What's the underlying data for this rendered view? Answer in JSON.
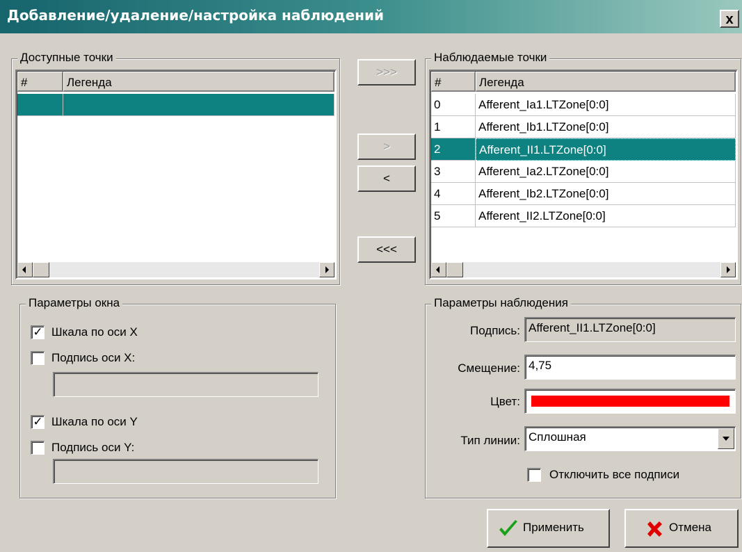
{
  "window": {
    "title": "Добавление/удаление/настройка наблюдений",
    "close_label": "x"
  },
  "available": {
    "group_label": "Доступные точки",
    "col_num": "#",
    "col_legend": "Легенда",
    "rows": [
      {
        "num": "",
        "legend": ""
      }
    ]
  },
  "transfer": {
    "add_all": ">>>",
    "add": ">",
    "remove": "<",
    "remove_all": "<<<"
  },
  "observed": {
    "group_label": "Наблюдаемые точки",
    "col_num": "#",
    "col_legend": "Легенда",
    "selected_index": 2,
    "rows": [
      {
        "num": "0",
        "legend": "Afferent_Ia1.LTZone[0:0]"
      },
      {
        "num": "1",
        "legend": "Afferent_Ib1.LTZone[0:0]"
      },
      {
        "num": "2",
        "legend": "Afferent_II1.LTZone[0:0]"
      },
      {
        "num": "3",
        "legend": "Afferent_Ia2.LTZone[0:0]"
      },
      {
        "num": "4",
        "legend": "Afferent_Ib2.LTZone[0:0]"
      },
      {
        "num": "5",
        "legend": "Afferent_II2.LTZone[0:0]"
      }
    ]
  },
  "window_params": {
    "group_label": "Параметры окна",
    "scale_x": {
      "label": "Шкала по оси X",
      "checked": true
    },
    "caption_x": {
      "label": "Подпись оси X:",
      "checked": false,
      "value": ""
    },
    "scale_y": {
      "label": "Шкала по оси Y",
      "checked": true
    },
    "caption_y": {
      "label": "Подпись оси Y:",
      "checked": false,
      "value": ""
    }
  },
  "obs_params": {
    "group_label": "Параметры наблюдения",
    "caption_label": "Подпись:",
    "caption_value": "Afferent_II1.LTZone[0:0]",
    "offset_label": "Смещение:",
    "offset_value": "4,75",
    "color_label": "Цвет:",
    "color_value": "#ff0000",
    "linetype_label": "Тип линии:",
    "linetype_value": "Сплошная",
    "disable_captions": {
      "label": "Отключить все подписи",
      "checked": false
    }
  },
  "buttons": {
    "apply": "Применить",
    "cancel": "Отмена",
    "apply_icon_color": "#1aa01a",
    "cancel_icon_color": "#e00000"
  }
}
